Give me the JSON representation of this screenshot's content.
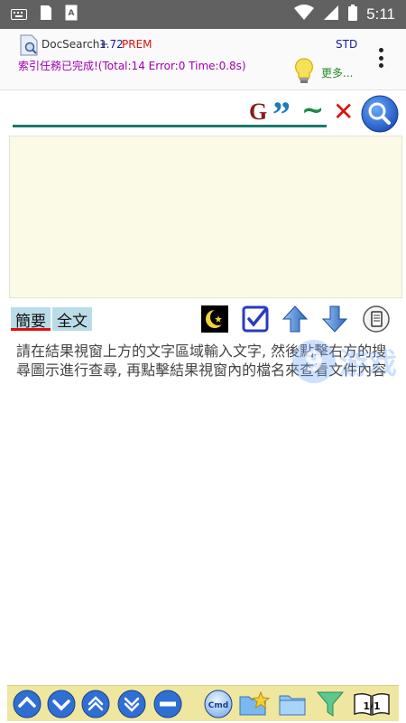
{
  "status_bar": {
    "time": "5:11",
    "icons": [
      "keyboard-icon",
      "sim-card-icon",
      "a-badge-icon",
      "wifi-icon",
      "signal-icon",
      "battery-icon"
    ]
  },
  "app_bar": {
    "app_name": "DocSearch+",
    "version": "1.72",
    "edition": "PREM",
    "mode": "STD",
    "status_message": "索引任務已完成!(Total:14 Error:0 Time:0.8s)",
    "more_label": "更多...",
    "menu_icon": "more-vert-icon"
  },
  "search": {
    "value": "",
    "placeholder": "",
    "google_label": "G",
    "quote_label": "”",
    "tilde_label": "~",
    "clear_label": "✕"
  },
  "tabs": [
    {
      "label": "簡要",
      "active": true
    },
    {
      "label": "全文",
      "active": false
    }
  ],
  "toolbar_icons": [
    "night-mode-icon",
    "checkbox-icon",
    "arrow-up-icon",
    "arrow-down-icon",
    "reader-icon"
  ],
  "help_text": "請在結果視窗上方的文字區域輸入文字, 然後點擊右方的搜尋圖示進行查尋, 再點擊結果視窗內的檔名來查看文件內容",
  "watermark": "9游戏",
  "bottom_bar": {
    "cmd_label": "Cmd",
    "page_indicator": "1/1",
    "icons": [
      "double-up-icon",
      "double-down-icon",
      "up-icon",
      "down-icon",
      "minus-icon",
      "cmd-icon",
      "favorites-folder-icon",
      "folder-icon",
      "filter-icon",
      "book-page-icon"
    ]
  },
  "colors": {
    "status_bar": "#616161",
    "accent_teal": "#1a7a6a",
    "result_bg": "#fafae6",
    "bottom_bar": "#efe6a0",
    "tab_bg": "#b9dce8",
    "status_text": "#a000b0"
  }
}
